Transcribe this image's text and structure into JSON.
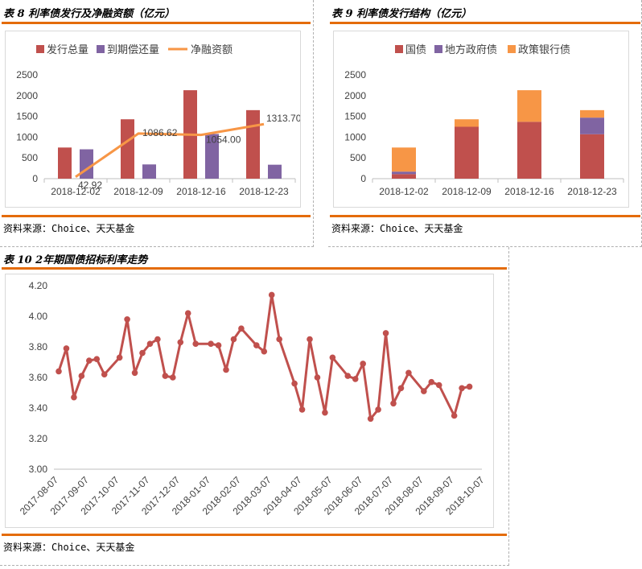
{
  "panels": {
    "p8": {
      "title": "表 8  利率债发行及净融资额（亿元）",
      "source": "资料来源：Choice、天天基金"
    },
    "p9": {
      "title": "表 9  利率债发行结构（亿元）",
      "source": "资料来源：Choice、天天基金"
    },
    "p10": {
      "title": "表 10  2年期国债招标利率走势",
      "source": "资料来源：Choice、天天基金"
    }
  },
  "colors": {
    "red": "#c0504d",
    "purple": "#8064a2",
    "orange": "#f79646",
    "accent_rule": "#e46c0a"
  },
  "chart_data": [
    {
      "id": "chart8",
      "type": "bar",
      "categories": [
        "2018-12-02",
        "2018-12-09",
        "2018-12-16",
        "2018-12-23"
      ],
      "series": [
        {
          "name": "发行总量",
          "type": "bar",
          "color": "#c0504d",
          "values": [
            750,
            1430,
            2130,
            1650
          ]
        },
        {
          "name": "到期偿还量",
          "type": "bar",
          "color": "#8064a2",
          "values": [
            707,
            343,
            1076,
            336
          ]
        },
        {
          "name": "净融资额",
          "type": "line",
          "color": "#f79646",
          "values": [
            42.92,
            1086.62,
            1054.0,
            1313.7
          ],
          "labels": [
            "42.92",
            "1086.62",
            "1054.00",
            "1313.70"
          ]
        }
      ],
      "ylim": [
        0,
        2500
      ],
      "yticks": [
        "0",
        "500",
        "1000",
        "1500",
        "2000",
        "2500"
      ],
      "ytick_values": [
        0,
        500,
        1000,
        1500,
        2000,
        2500
      ],
      "legend_position": "top",
      "grid": false
    },
    {
      "id": "chart9",
      "type": "bar",
      "stacked": true,
      "categories": [
        "2018-12-02",
        "2018-12-09",
        "2018-12-16",
        "2018-12-23"
      ],
      "series": [
        {
          "name": "国债",
          "color": "#c0504d",
          "values": [
            110,
            1250,
            1370,
            1070
          ]
        },
        {
          "name": "地方政府债",
          "color": "#8064a2",
          "values": [
            60,
            0,
            0,
            400
          ]
        },
        {
          "name": "政策银行债",
          "color": "#f79646",
          "values": [
            580,
            180,
            760,
            180
          ]
        }
      ],
      "ylim": [
        0,
        2500
      ],
      "yticks": [
        "0",
        "500",
        "1000",
        "1500",
        "2000",
        "2500"
      ],
      "ytick_values": [
        0,
        500,
        1000,
        1500,
        2000,
        2500
      ],
      "legend_position": "top",
      "grid": false
    },
    {
      "id": "chart10",
      "type": "line",
      "series": [
        {
          "name": "",
          "color": "#c0504d",
          "values": [
            3.64,
            3.79,
            3.47,
            3.61,
            3.71,
            3.72,
            3.62,
            3.73,
            3.98,
            3.63,
            3.76,
            3.82,
            3.85,
            3.61,
            3.6,
            3.83,
            4.02,
            3.82,
            3.82,
            3.81,
            3.65,
            3.85,
            3.92,
            3.81,
            3.77,
            4.14,
            3.85,
            3.56,
            3.39,
            3.85,
            3.6,
            3.37,
            3.73,
            3.61,
            3.59,
            3.69,
            3.33,
            3.39,
            3.89,
            3.43,
            3.53,
            3.63,
            3.51,
            3.57,
            3.55,
            3.35,
            3.53,
            3.54
          ]
        }
      ],
      "point_index": [
        0,
        1,
        2,
        3,
        4,
        5,
        6,
        8,
        9,
        10,
        11,
        12,
        13,
        14,
        15,
        16,
        17,
        18,
        20,
        21,
        22,
        23,
        24,
        26,
        27,
        28,
        29,
        31,
        32,
        33,
        34,
        35,
        36,
        38,
        39,
        40,
        41,
        42,
        43,
        44,
        45,
        46,
        48,
        49,
        50,
        52,
        53,
        54
      ],
      "x_count": 56,
      "xticks": [
        "2017-08-07",
        "2017-09-07",
        "2017-10-07",
        "2017-11-07",
        "2017-12-07",
        "2018-01-07",
        "2018-02-07",
        "2018-03-07",
        "2018-04-07",
        "2018-05-07",
        "2018-06-07",
        "2018-07-07",
        "2018-08-07",
        "2018-09-07",
        "2018-10-07"
      ],
      "yticks": [
        "3.00",
        "3.20",
        "3.40",
        "3.60",
        "3.80",
        "4.00",
        "4.20"
      ],
      "ytick_values": [
        3.0,
        3.2,
        3.4,
        3.6,
        3.8,
        4.0,
        4.2
      ],
      "ylim": [
        3.0,
        4.2
      ],
      "grid": false
    }
  ]
}
